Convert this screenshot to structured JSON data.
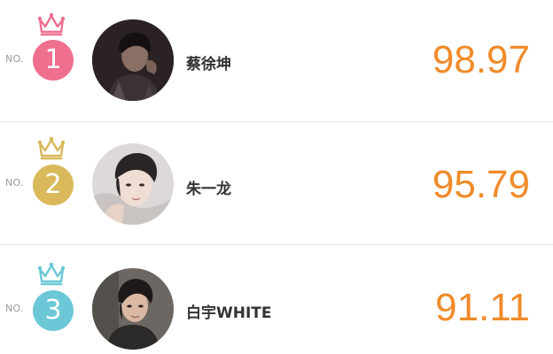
{
  "colors": {
    "rank1": "#ef6f8f",
    "rank2": "#d9b95a",
    "rank3": "#6cc8d6",
    "score": "#f08b2a",
    "divider": "#e6e6e6"
  },
  "rankings": [
    {
      "no_label": "NO.",
      "rank": "1",
      "name": "蔡徐坤",
      "score": "98.97",
      "crown_icon": "crown-icon",
      "avatar_icon": "avatar-photo"
    },
    {
      "no_label": "NO.",
      "rank": "2",
      "name": "朱一龙",
      "score": "95.79",
      "crown_icon": "crown-icon",
      "avatar_icon": "avatar-photo"
    },
    {
      "no_label": "NO.",
      "rank": "3",
      "name": "白宇WHITE",
      "score": "91.11",
      "crown_icon": "crown-icon",
      "avatar_icon": "avatar-photo"
    }
  ]
}
